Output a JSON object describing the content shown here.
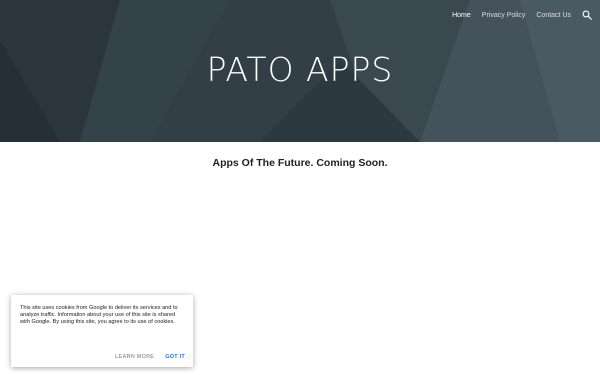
{
  "header": {
    "site_title": "PATO APPS",
    "nav": {
      "items": [
        {
          "label": "Home",
          "active": true
        },
        {
          "label": "Privacy Policy",
          "active": false
        },
        {
          "label": "Contact Us",
          "active": false
        }
      ],
      "search_icon": "search-icon"
    },
    "background_color": "#2f3b42"
  },
  "main": {
    "tagline": "Apps Of The Future. Coming Soon."
  },
  "cookie_banner": {
    "text": "This site uses cookies from Google to deliver its services and to analyze traffic. Information about your use of this site is shared with Google. By using this site, you agree to its use of cookies.",
    "learn_more_label": "LEARN MORE",
    "got_it_label": "GOT IT",
    "accent_color": "#1a73e8"
  }
}
